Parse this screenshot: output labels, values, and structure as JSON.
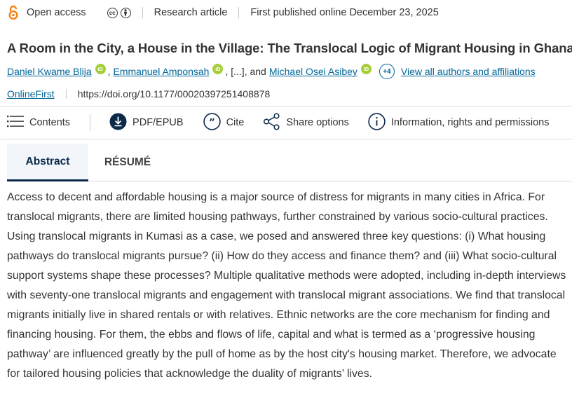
{
  "meta": {
    "open_access_label": "Open access",
    "article_type": "Research article",
    "published": "First published online December 23, 2025"
  },
  "title": "A Room in the City, a House in the Village: The Translocal Logic of Migrant Housing in Ghana",
  "authors": {
    "list": [
      "Daniel Kwame Blija",
      "Emmanuel Amponsah",
      "Michael Osei Asibey"
    ],
    "sep1": ",",
    "ellipsis": ", [...], and",
    "more_count": "+4",
    "view_all": "View all authors and affiliations"
  },
  "doi_row": {
    "status": "OnlineFirst",
    "doi": "https://doi.org/10.1177/00020397251408878"
  },
  "toolbar": {
    "contents": "Contents",
    "pdf": "PDF/EPUB",
    "cite": "Cite",
    "share": "Share options",
    "info": "Information, rights and permissions"
  },
  "tabs": {
    "abstract": "Abstract",
    "resume": "RÉSUMÉ"
  },
  "abstract_text": "Access to decent and affordable housing is a major source of distress for migrants in many cities in Africa. For translocal migrants, there are limited housing pathways, further constrained by various socio-cultural practices. Using translocal migrants in Kumasi as a case, we posed and answered three key questions: (i) What housing pathways do translocal migrants pursue? (ii) How do they access and finance them? and (iii) What socio-cultural support systems shape these processes? Multiple qualitative methods were adopted, including in-depth interviews with seventy-one translocal migrants and engagement with translocal migrant associations. We find that translocal migrants initially live in shared rentals or with relatives. Ethnic networks are the core mechanism for finding and financing housing. For them, the ebbs and flows of life, capital and what is termed as a ‘progressive housing pathway’ are influenced greatly by the pull of home as by the host city's housing market. Therefore, we advocate for tailored housing policies that acknowledge the duality of migrants’ lives.",
  "icons": {
    "open_access": "open-access-lock-icon",
    "cc": "creative-commons-icon",
    "by": "attribution-icon",
    "orcid": "orcid-icon",
    "contents": "hamburger-menu-icon",
    "pdf": "download-icon",
    "cite": "quote-icon",
    "share": "share-icon",
    "info": "info-icon"
  },
  "colors": {
    "link": "#006699",
    "open_access": "#f68212",
    "orcid": "#a6ce39",
    "tab_active": "#0b2a4a",
    "tab_bg": "#f2f5f9"
  }
}
